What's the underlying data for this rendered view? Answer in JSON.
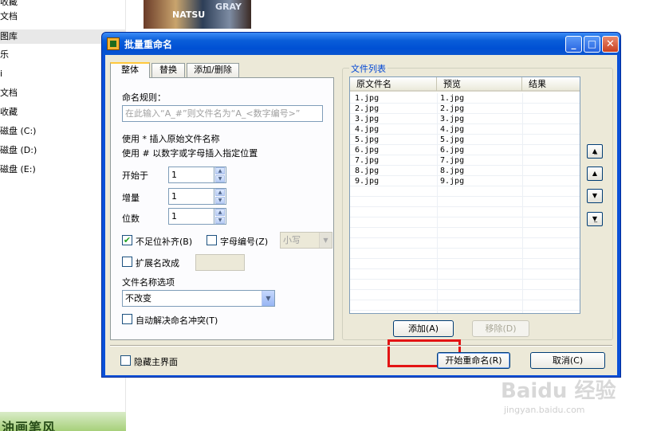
{
  "background": {
    "sidebar_items": [
      {
        "label": "收藏"
      },
      {
        "label": "文档"
      },
      {
        "label": "图库"
      },
      {
        "label": "乐"
      },
      {
        "label": "i"
      },
      {
        "label": "文档"
      },
      {
        "label": "收藏"
      },
      {
        "label": "磁盘 (C:)"
      },
      {
        "label": "磁盘 (D:)"
      },
      {
        "label": "磁盘 (E:)"
      }
    ],
    "thumb_text_left": "NATSU",
    "thumb_text_right": "GRAY",
    "bottom_thumb_text": "油画笔风",
    "watermark": "Baidu 经验",
    "watermark_url": "jingyan.baidu.com"
  },
  "dialog": {
    "title": "批量重命名",
    "tabs": [
      {
        "label": "整体"
      },
      {
        "label": "替换"
      },
      {
        "label": "添加/删除"
      }
    ],
    "rule_label": "命名规则：",
    "rule_placeholder": "在此输入“A_#”则文件名为“A_<数字编号>”",
    "hint_1": "使用 * 插入原始文件名称",
    "hint_2": "使用 # 以数字或字母插入指定位置",
    "start_label": "开始于",
    "start_value": "1",
    "step_label": "增量",
    "step_value": "1",
    "digits_label": "位数",
    "digits_value": "1",
    "pad_label": "不足位补齐(B)",
    "pad_checked": "✔",
    "letter_label": "字母编号(Z)",
    "case_value": "小写",
    "ext_label": "扩展名改成",
    "filename_options_label": "文件名称选项",
    "filename_option_value": "不改变",
    "auto_resolve_label": "自动解决命名冲突(T)",
    "file_list_title": "文件列表",
    "columns": [
      "原文件名",
      "预览",
      "结果"
    ],
    "rows": [
      {
        "original": "1.jpg",
        "preview": "1.jpg",
        "result": ""
      },
      {
        "original": "2.jpg",
        "preview": "2.jpg",
        "result": ""
      },
      {
        "original": "3.jpg",
        "preview": "3.jpg",
        "result": ""
      },
      {
        "original": "4.jpg",
        "preview": "4.jpg",
        "result": ""
      },
      {
        "original": "5.jpg",
        "preview": "5.jpg",
        "result": ""
      },
      {
        "original": "6.jpg",
        "preview": "6.jpg",
        "result": ""
      },
      {
        "original": "7.jpg",
        "preview": "7.jpg",
        "result": ""
      },
      {
        "original": "8.jpg",
        "preview": "8.jpg",
        "result": ""
      },
      {
        "original": "9.jpg",
        "preview": "9.jpg",
        "result": ""
      }
    ],
    "add_label": "添加(A)",
    "remove_label": "移除(D)",
    "hide_main_label": "隐藏主界面",
    "start_rename_label": "开始重命名(R)",
    "cancel_label": "取消(C)",
    "move_top": "▲̲",
    "move_up": "▲",
    "move_down": "▼",
    "move_bottom": "▼̲",
    "title_min": "_",
    "title_max": "□",
    "title_close": "✕"
  }
}
